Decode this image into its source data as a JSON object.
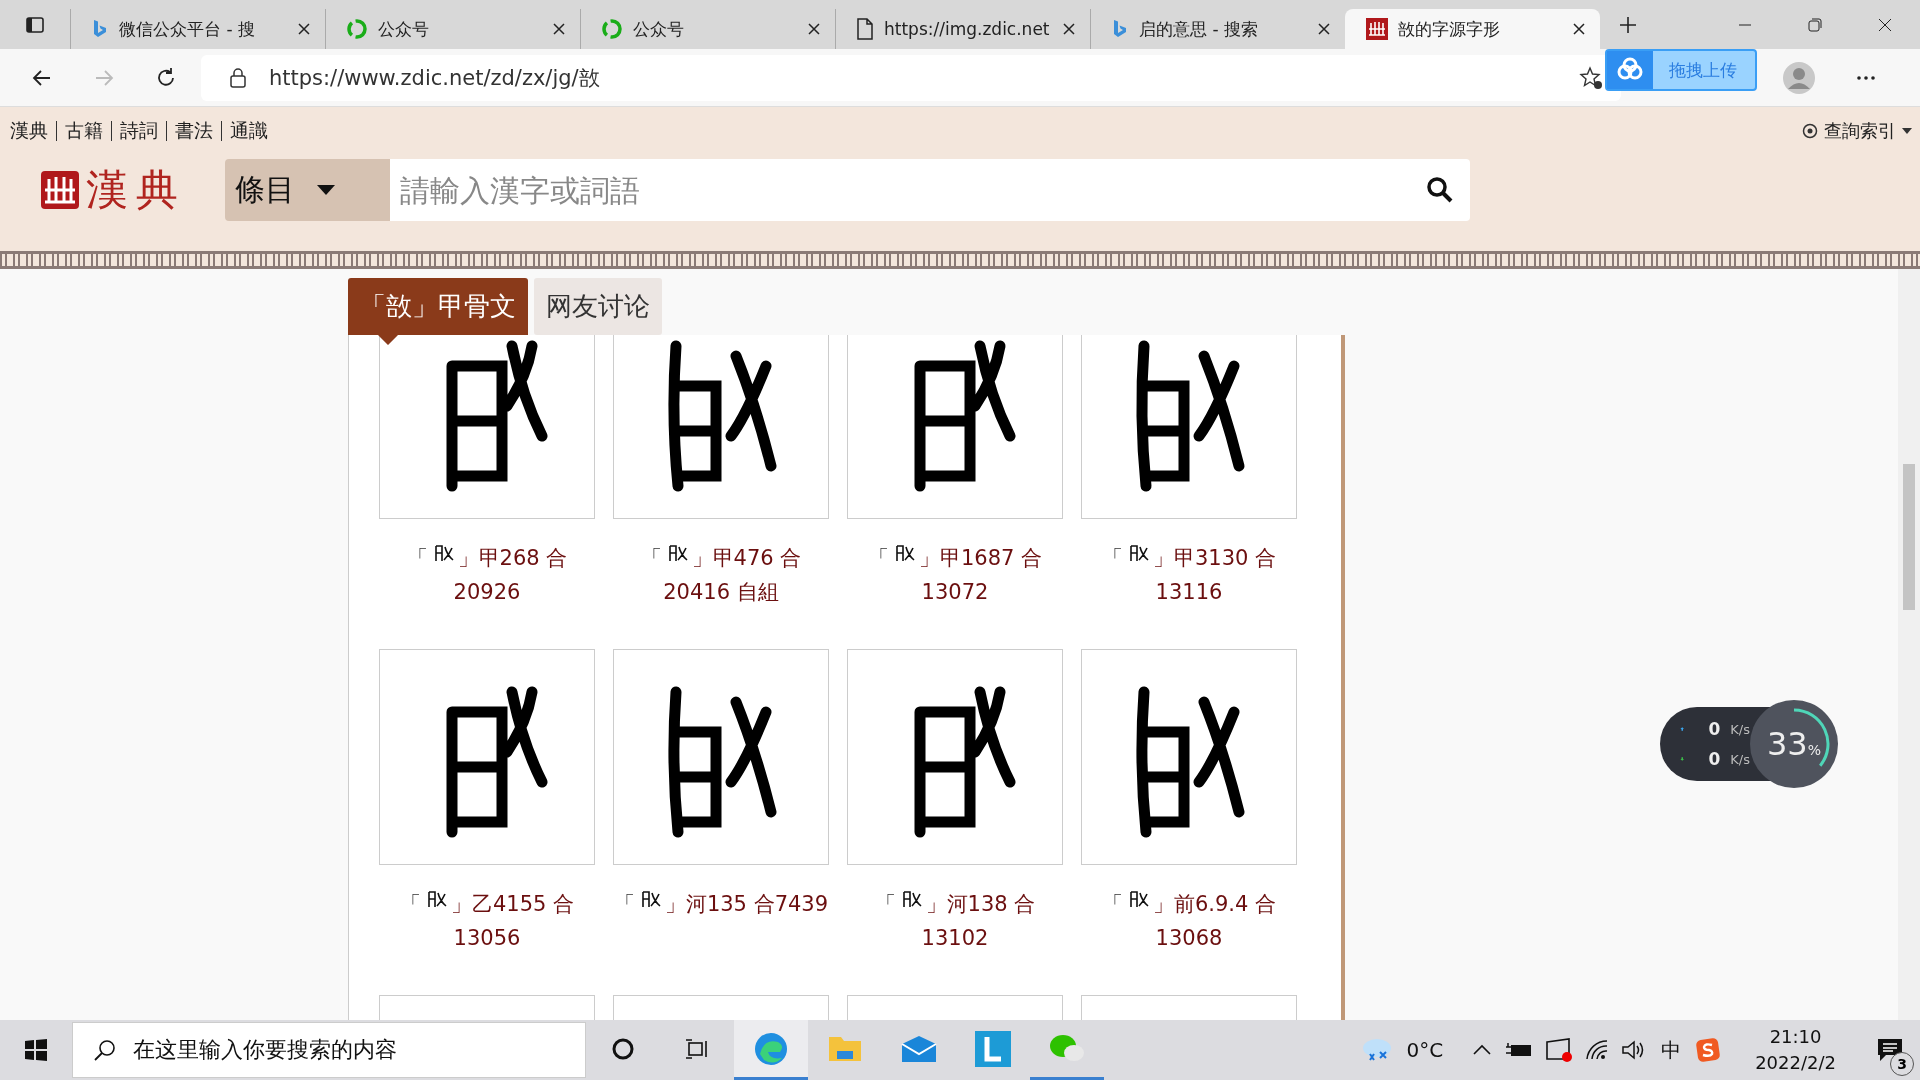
{
  "browser": {
    "tabs": [
      {
        "kind": "bing",
        "title": "微信公众平台 - 搜",
        "selected": false
      },
      {
        "kind": "wechat",
        "title": "公众号",
        "selected": false
      },
      {
        "kind": "wechat",
        "title": "公众号",
        "selected": false
      },
      {
        "kind": "page",
        "title": "https://img.zdic.net",
        "selected": false
      },
      {
        "kind": "bing",
        "title": "启的意思 - 搜索",
        "selected": false
      },
      {
        "kind": "zdic",
        "title": "敨的字源字形",
        "selected": true
      }
    ],
    "url": "https://www.zdic.net/zd/zx/jg/敨",
    "upload": "拖拽上传"
  },
  "site": {
    "nav": [
      "漢典",
      "古籍",
      "詩詞",
      "書法",
      "通識"
    ],
    "index_link": "查詢索引",
    "logo": "漢典",
    "search": {
      "scope": "條目",
      "placeholder": "請輸入漢字或詞語"
    }
  },
  "tabs": [
    {
      "label": "「敨」甲骨文",
      "selected": true
    },
    {
      "label": "网友讨论",
      "selected": false
    }
  ],
  "cards": [
    {
      "open": "「",
      "close": "」甲268 合",
      "line2": "20926"
    },
    {
      "open": "「",
      "close": "」甲476 合",
      "line2": "20416 自組"
    },
    {
      "open": "「",
      "close": "」甲1687 合",
      "line2": "13072"
    },
    {
      "open": "「",
      "close": "」甲3130 合",
      "line2": "13116"
    },
    {
      "open": "「",
      "close": "」乙4155 合",
      "line2": "13056"
    },
    {
      "open": "「",
      "close": "」河135 合7439"
    },
    {
      "open": "「",
      "close": "」河138 合",
      "line2": "13102"
    },
    {
      "open": "「",
      "close": "」前6.9.4 合",
      "line2": "13068"
    }
  ],
  "speed_widget": {
    "up": "0",
    "down": "0",
    "up_unit": "K/s",
    "down_unit": "K/s",
    "percent": "33",
    "percent_sign": "%"
  },
  "taskbar": {
    "search_placeholder": "在这里输入你要搜索的内容",
    "apps": [
      {
        "kind": "cortana",
        "selected": false,
        "running": false
      },
      {
        "kind": "taskview",
        "selected": false,
        "running": false
      },
      {
        "kind": "edge",
        "selected": true,
        "running": true
      },
      {
        "kind": "explorer",
        "selected": false,
        "running": false
      },
      {
        "kind": "mail",
        "selected": false,
        "running": false
      },
      {
        "kind": "lapp",
        "selected": false,
        "running": false
      },
      {
        "kind": "wechat",
        "selected": false,
        "running": true
      }
    ],
    "temperature": "0°C",
    "ime": "中",
    "time": "21:10",
    "date": "2022/2/2",
    "notifications": "3"
  }
}
